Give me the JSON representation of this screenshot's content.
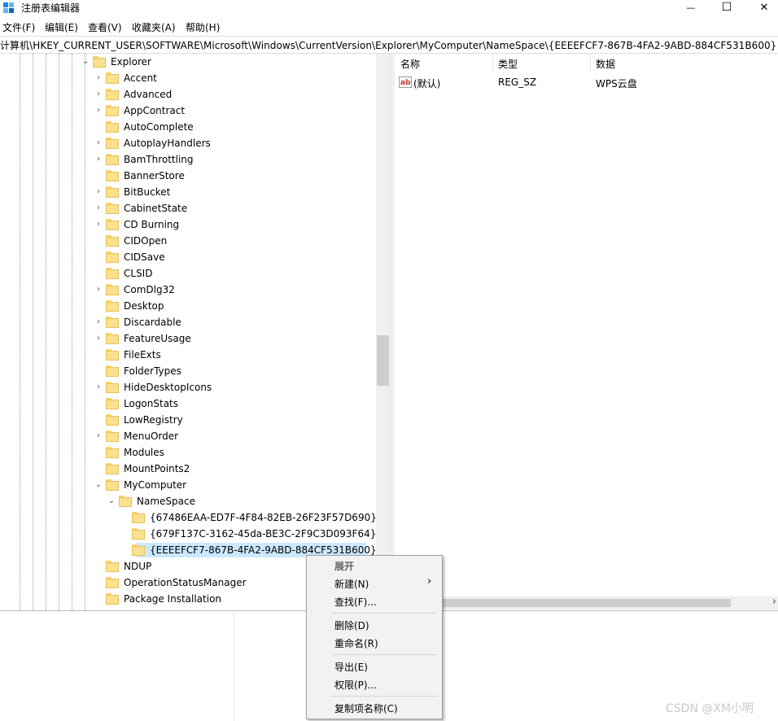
{
  "window": {
    "title": "注册表编辑器",
    "minimize_glyph": "—",
    "maximize_glyph": "☐",
    "close_glyph": "✕"
  },
  "menu": [
    "文件(F)",
    "编辑(E)",
    "查看(V)",
    "收藏夹(A)",
    "帮助(H)"
  ],
  "address": "计算机\\HKEY_CURRENT_USER\\SOFTWARE\\Microsoft\\Windows\\CurrentVersion\\Explorer\\MyComputer\\NameSpace\\{EEEEFCF7-867B-4FA2-9ABD-884CF531B600}",
  "tree": {
    "root": "Explorer",
    "items": [
      "Accent",
      "Advanced",
      "AppContract",
      "AutoComplete",
      "AutoplayHandlers",
      "BamThrottling",
      "BannerStore",
      "BitBucket",
      "CabinetState",
      "CD Burning",
      "CIDOpen",
      "CIDSave",
      "CLSID",
      "ComDlg32",
      "Desktop",
      "Discardable",
      "FeatureUsage",
      "FileExts",
      "FolderTypes",
      "HideDesktopIcons",
      "LogonStats",
      "LowRegistry",
      "MenuOrder",
      "Modules",
      "MountPoints2",
      "MyComputer"
    ],
    "namespace": "NameSpace",
    "namespace_children": [
      "{67486EAA-ED7F-4F84-82EB-26F23F57D690}",
      "{679F137C-3162-45da-BE3C-2F9C3D093F64}",
      "{EEEEFCF7-867B-4FA2-9ABD-884CF531B600}"
    ],
    "after": [
      "NDUP",
      "OperationStatusManager",
      "Package Installation"
    ]
  },
  "values_pane": {
    "headers": {
      "name": "名称",
      "type": "类型",
      "data": "数据"
    },
    "rows": [
      {
        "name": "(默认)",
        "type": "REG_SZ",
        "data": "WPS云盘",
        "icon": "ab-string-icon"
      }
    ]
  },
  "context_menu": {
    "expand": "展开",
    "new": "新建(N)",
    "new_arrow": "›",
    "find": "查找(F)...",
    "delete": "删除(D)",
    "rename": "重命名(R)",
    "export": "导出(E)",
    "permissions": "权限(P)...",
    "copy_key": "复制项名称(C)"
  },
  "hscroll_arrow": "›",
  "watermark": "CSDN @XM小明"
}
